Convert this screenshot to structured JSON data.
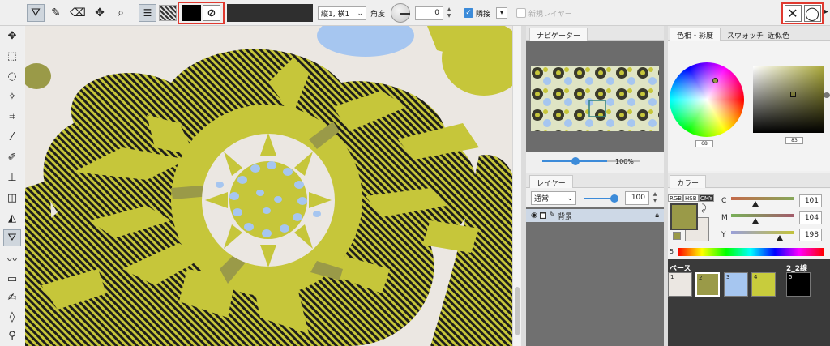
{
  "toolbar_top": {
    "stroke_select": "縦1, 横1",
    "angle_label": "角度",
    "angle_value": "0",
    "adjacent_label": "隣接",
    "new_layer_label": "新規レイヤー"
  },
  "navigator": {
    "tab": "ナビゲーター",
    "zoom_value": "100%"
  },
  "layers": {
    "tab": "レイヤー",
    "blend_mode": "通常",
    "opacity": "100",
    "layer_name": "背景"
  },
  "color_panel": {
    "tabs": [
      "色相・彩度",
      "スウォッチ",
      "近似色"
    ],
    "saturation_value": "68",
    "value_value": "83"
  },
  "color_mixer": {
    "tab": "カラー",
    "modes": [
      "RGB",
      "HSB",
      "CMY"
    ],
    "channels": [
      {
        "label": "C",
        "value": "101"
      },
      {
        "label": "M",
        "value": "104"
      },
      {
        "label": "Y",
        "value": "198"
      }
    ],
    "index_label": "5"
  },
  "color_set": {
    "name_left": "ベース",
    "name_right": "2_2線",
    "swatches": [
      {
        "num": "1",
        "color": "#ebe7e2"
      },
      {
        "num": "2",
        "color": "#9a9a48"
      },
      {
        "num": "3",
        "color": "#a6c6f0"
      },
      {
        "num": "4",
        "color": "#c8cc3c"
      },
      {
        "num": "5",
        "color": "#000000"
      }
    ]
  },
  "colors": {
    "hatch_dark": "#1e1e1a",
    "olive": "#c6c63a",
    "dark_olive": "#9a9a48",
    "light_blue": "#a6c6f0",
    "cream": "#ebe7e2",
    "accent": "#3c8bd9",
    "highlight": "#e0392f"
  },
  "icons": [
    "fill-mode-icon",
    "fill-tool-icon",
    "eraser-fill-icon",
    "move-fill-icon",
    "zoom-fill-icon",
    "settings-sliders-icon",
    "close-icon",
    "circle-ok-icon"
  ]
}
